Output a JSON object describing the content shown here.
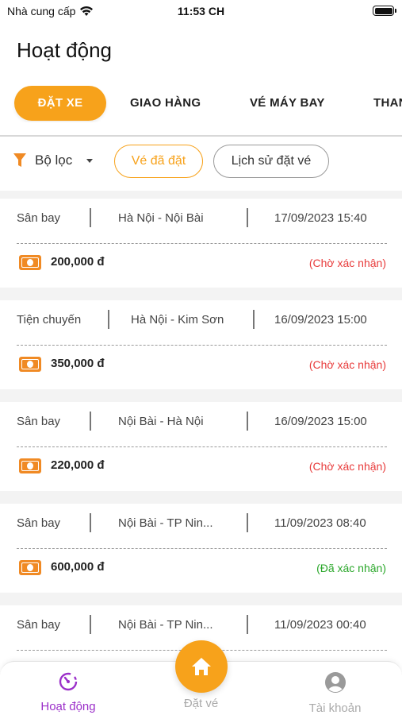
{
  "status_bar": {
    "carrier": "Nhà cung cấp",
    "time": "11:53 CH"
  },
  "header": {
    "title": "Hoạt động"
  },
  "tabs": [
    {
      "label": "ĐẶT XE"
    },
    {
      "label": "GIAO HÀNG"
    },
    {
      "label": "VÉ MÁY BAY"
    },
    {
      "label": "THAN"
    }
  ],
  "filters": {
    "filter_label": "Bộ lọc",
    "chip_booked": "Vé đã đặt",
    "chip_history": "Lịch sử đặt vé"
  },
  "bookings": [
    {
      "type": "Sân bay",
      "route": "Hà Nội - Nội Bài",
      "datetime": "17/09/2023 15:40",
      "price": "200,000 đ",
      "status": "(Chờ xác nhận)"
    },
    {
      "type": "Tiện chuyến",
      "route": "Hà Nội - Kim Sơn",
      "datetime": "16/09/2023 15:00",
      "price": "350,000 đ",
      "status": "(Chờ xác nhận)"
    },
    {
      "type": "Sân bay",
      "route": "Nội Bài - Hà Nội",
      "datetime": "16/09/2023 15:00",
      "price": "220,000 đ",
      "status": "(Chờ xác nhận)"
    },
    {
      "type": "Sân bay",
      "route": "Nội Bài - TP Nin...",
      "datetime": "11/09/2023 08:40",
      "price": "600,000 đ",
      "status": "(Đã xác nhận)"
    },
    {
      "type": "Sân bay",
      "route": "Nội Bài - TP Nin...",
      "datetime": "11/09/2023 00:40",
      "price": "",
      "status": ""
    }
  ],
  "bottom_nav": {
    "activity": "Hoạt động",
    "book": "Đặt vé",
    "account": "Tài khoản"
  },
  "colors": {
    "accent": "#f7a21b",
    "pending": "#e83b3b",
    "confirmed": "#2aa72a",
    "nav_active": "#9b2fc9"
  },
  "icons": [
    "wifi-icon",
    "battery-icon",
    "filter-icon",
    "caret-down-icon",
    "money-icon",
    "activity-icon",
    "home-icon",
    "account-icon"
  ]
}
